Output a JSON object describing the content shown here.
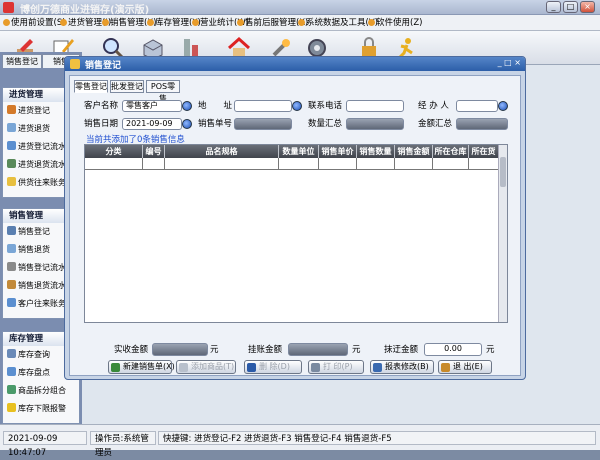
{
  "window": {
    "title": "博创万德商业进销存(演示版)",
    "min": "_",
    "max": "□",
    "close": "×"
  },
  "menu": [
    "使用前设置(S)",
    "进货管理(I)",
    "销售管理(X)",
    "库存管理(Y)",
    "营业统计(W)",
    "售前后服管理(K)",
    "系统数据及工具(V)",
    "软件使用(Z)"
  ],
  "sidebar": {
    "tabs": [
      "销售登记",
      "销售"
    ],
    "sections": [
      {
        "title": "进货管理",
        "items": [
          "进货登记",
          "进货退货",
          "进货登记流水",
          "进货退货流水",
          "供货往来账务"
        ]
      },
      {
        "title": "销售管理",
        "items": [
          "销售登记",
          "销售退货",
          "销售登记流水",
          "销售退货流水",
          "客户往来账务"
        ]
      },
      {
        "title": "库存管理",
        "items": [
          "库存查询",
          "库存盘点",
          "商品拆分组合",
          "库存下限报警"
        ]
      }
    ]
  },
  "dialog": {
    "title": "销售登记",
    "ctl": "_ □ ×",
    "tabs": [
      "零售登记",
      "批发登记",
      "POS零售"
    ],
    "fields": {
      "customer_label": "客户名称",
      "customer_value": "零售客户",
      "address_label": "地　　址",
      "contact_label": "联系电话",
      "handler_label": "经 办 人",
      "date_label": "销售日期",
      "date_value": "2021-09-09",
      "order_label": "销售单号",
      "qty_label": "数量汇总",
      "amount_label": "金额汇总"
    },
    "hint": "当前共添加了0条销售信息",
    "columns": [
      "分类",
      "编号",
      "品名规格",
      "数量单位",
      "销售单价",
      "销售数量",
      "销售金额",
      "所在仓库",
      "所在货位"
    ],
    "footer": {
      "received_label": "实收金额",
      "received_unit": "元",
      "owed_label": "挂账金额",
      "owed_unit": "元",
      "discount_label": "抹迂金额",
      "discount_value": "0.00",
      "discount_unit": "元"
    },
    "buttons": [
      "新建销售单(X)",
      "添加商品(T)",
      "删 除(D)",
      "打 印(P)",
      "报表修改(B)",
      "退 出(E)"
    ]
  },
  "status": {
    "datetime": "2021-09-09 10:47:07",
    "operator": "操作员:系统管理员",
    "shortcuts": "快捷键: 进货登记-F2 进货退货-F3 销售登记-F4 销售退货-F5"
  },
  "colors": {
    "dialog_header": "#2c5ea8",
    "hint_text": "#1f4fd0",
    "grid_header": "#40444c"
  }
}
